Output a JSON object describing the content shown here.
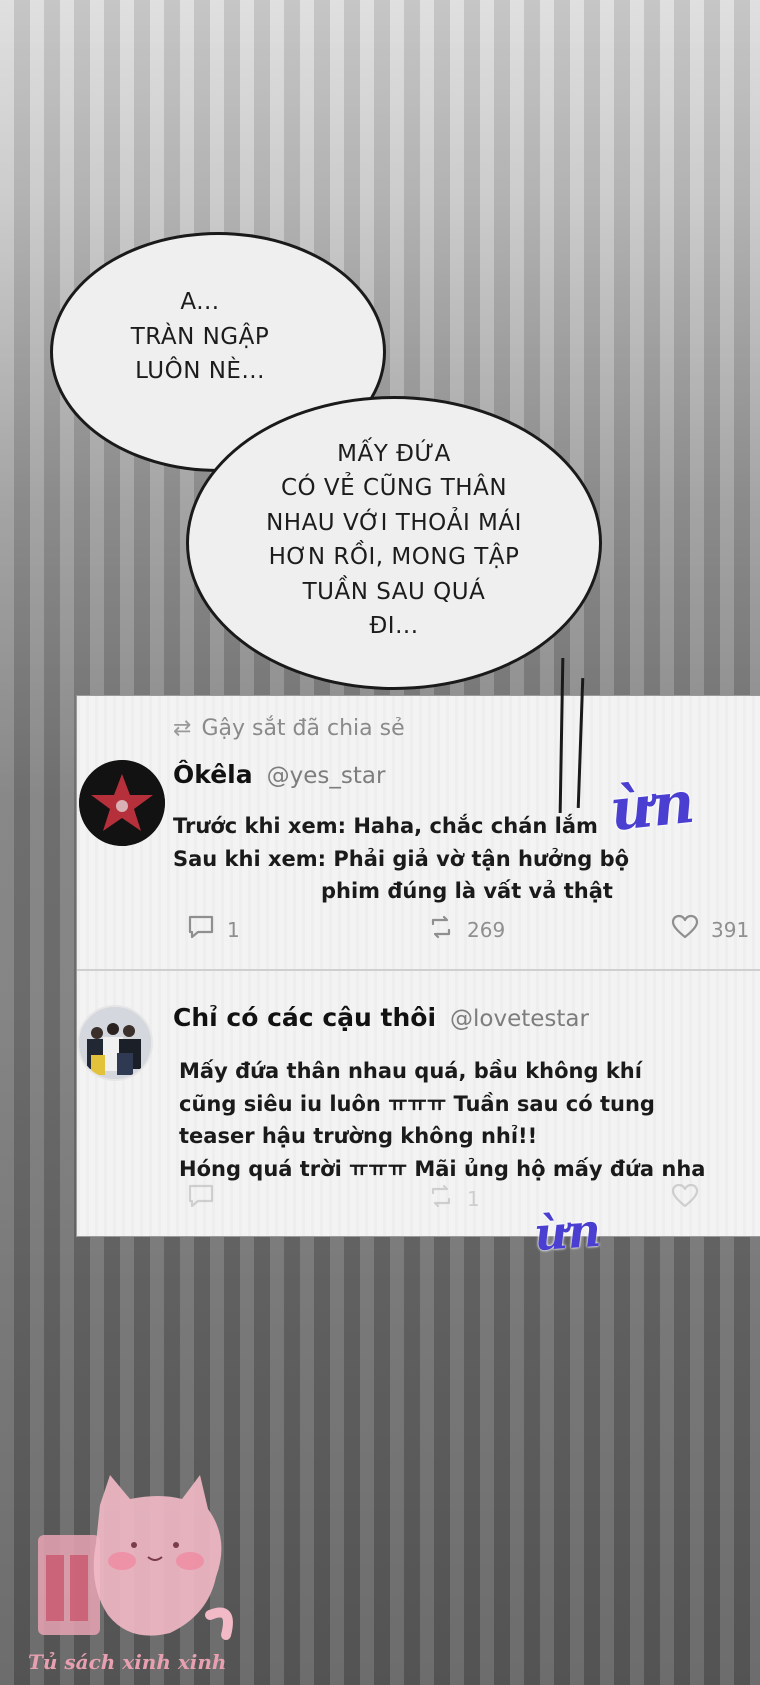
{
  "bubbles": {
    "first": [
      "A...",
      "TRÀN NGẬP",
      "LUÔN NÈ..."
    ],
    "second": [
      "MẤY ĐỨA",
      "CÓ VẺ CŨNG THÂN",
      "NHAU VỚI THOẢI MÁI",
      "HƠN RỒI, MONG TẬP",
      "TUẦN SAU QUÁ",
      "ĐI..."
    ]
  },
  "post1": {
    "repost_label": "Gậy sắt đã chia sẻ",
    "display_name": "Ôkêla",
    "username": "@yes_star",
    "lines": [
      "Trước khi xem: Haha, chắc chán lắm",
      "Sau khi xem: Phải giả vờ tận hưởng bộ",
      "phim đúng là vất vả thật"
    ],
    "replies": "1",
    "reposts": "269",
    "likes": "391"
  },
  "post2": {
    "display_name": "Chỉ có các cậu thôi",
    "username": "@lovetestar",
    "lines": [
      "Mấy đứa thân nhau quá, bầu không khí",
      "cũng siêu iu luôn ㅠㅠㅠ Tuần sau có tung",
      "teaser hậu trường không nhỉ!!",
      "Hóng quá trời ㅠㅠㅠ Mãi ủng hộ mấy đứa nha"
    ],
    "reposts": "1"
  },
  "scribbles": [
    "ừn",
    "ừn"
  ],
  "watermark": "Tủ sách xinh xinh",
  "colors": {
    "scribble": "#4a3fd0",
    "bubble_fill": "#efefef",
    "card_bg": "#f3f3f3",
    "watermark": "#e8a0b0"
  },
  "icons": [
    "reply-icon",
    "repost-icon",
    "like-icon"
  ]
}
